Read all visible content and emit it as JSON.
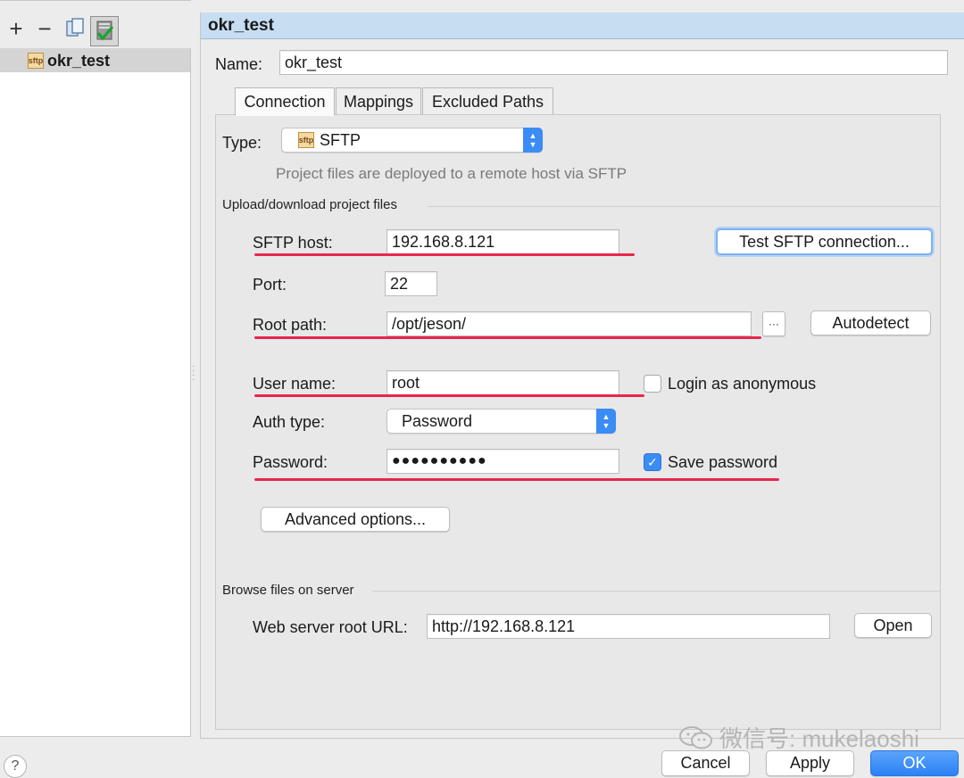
{
  "left_toolbar": {
    "add_icon": "plus-icon",
    "remove_icon": "minus-icon",
    "copy_icon": "copy-icon",
    "default_icon": "checkmark-server-icon"
  },
  "servers": [
    {
      "label": "okr_test",
      "icon": "sftp-icon"
    }
  ],
  "panel_title": "okr_test",
  "name": {
    "label": "Name:",
    "value": "okr_test"
  },
  "tabs": [
    {
      "label": "Connection",
      "active": true
    },
    {
      "label": "Mappings",
      "active": false
    },
    {
      "label": "Excluded Paths",
      "active": false
    }
  ],
  "type": {
    "label": "Type:",
    "value": "SFTP",
    "badge": "sftp",
    "hint": "Project files are deployed to a remote host via SFTP"
  },
  "upload_section": {
    "title": "Upload/download project files",
    "sftp_host": {
      "label": "SFTP host:",
      "value": "192.168.8.121"
    },
    "test_button": "Test SFTP connection...",
    "port": {
      "label": "Port:",
      "value": "22"
    },
    "root_path": {
      "label": "Root path:",
      "value": "/opt/jeson/",
      "browse": "···"
    },
    "autodetect_button": "Autodetect",
    "user_name": {
      "label": "User name:",
      "value": "root"
    },
    "anonymous": {
      "label": "Login as anonymous",
      "checked": false
    },
    "auth_type": {
      "label": "Auth type:",
      "value": "Password"
    },
    "password": {
      "label": "Password:",
      "value": "●●●●●●●●●●"
    },
    "save_password": {
      "label": "Save password",
      "checked": true,
      "mark": "✓"
    },
    "advanced_button": "Advanced options..."
  },
  "browse_section": {
    "title": "Browse files on server",
    "web_root": {
      "label": "Web server root URL:",
      "value": "http://192.168.8.121"
    },
    "open_button": "Open"
  },
  "footer": {
    "help": "?",
    "cancel": "Cancel",
    "apply": "Apply",
    "ok": "OK"
  },
  "watermark": "微信号: mukelaoshi",
  "colors": {
    "accent": "#3b8cf4",
    "highlight_underline": "#e8264c",
    "title_bar": "#c7ddf2"
  }
}
